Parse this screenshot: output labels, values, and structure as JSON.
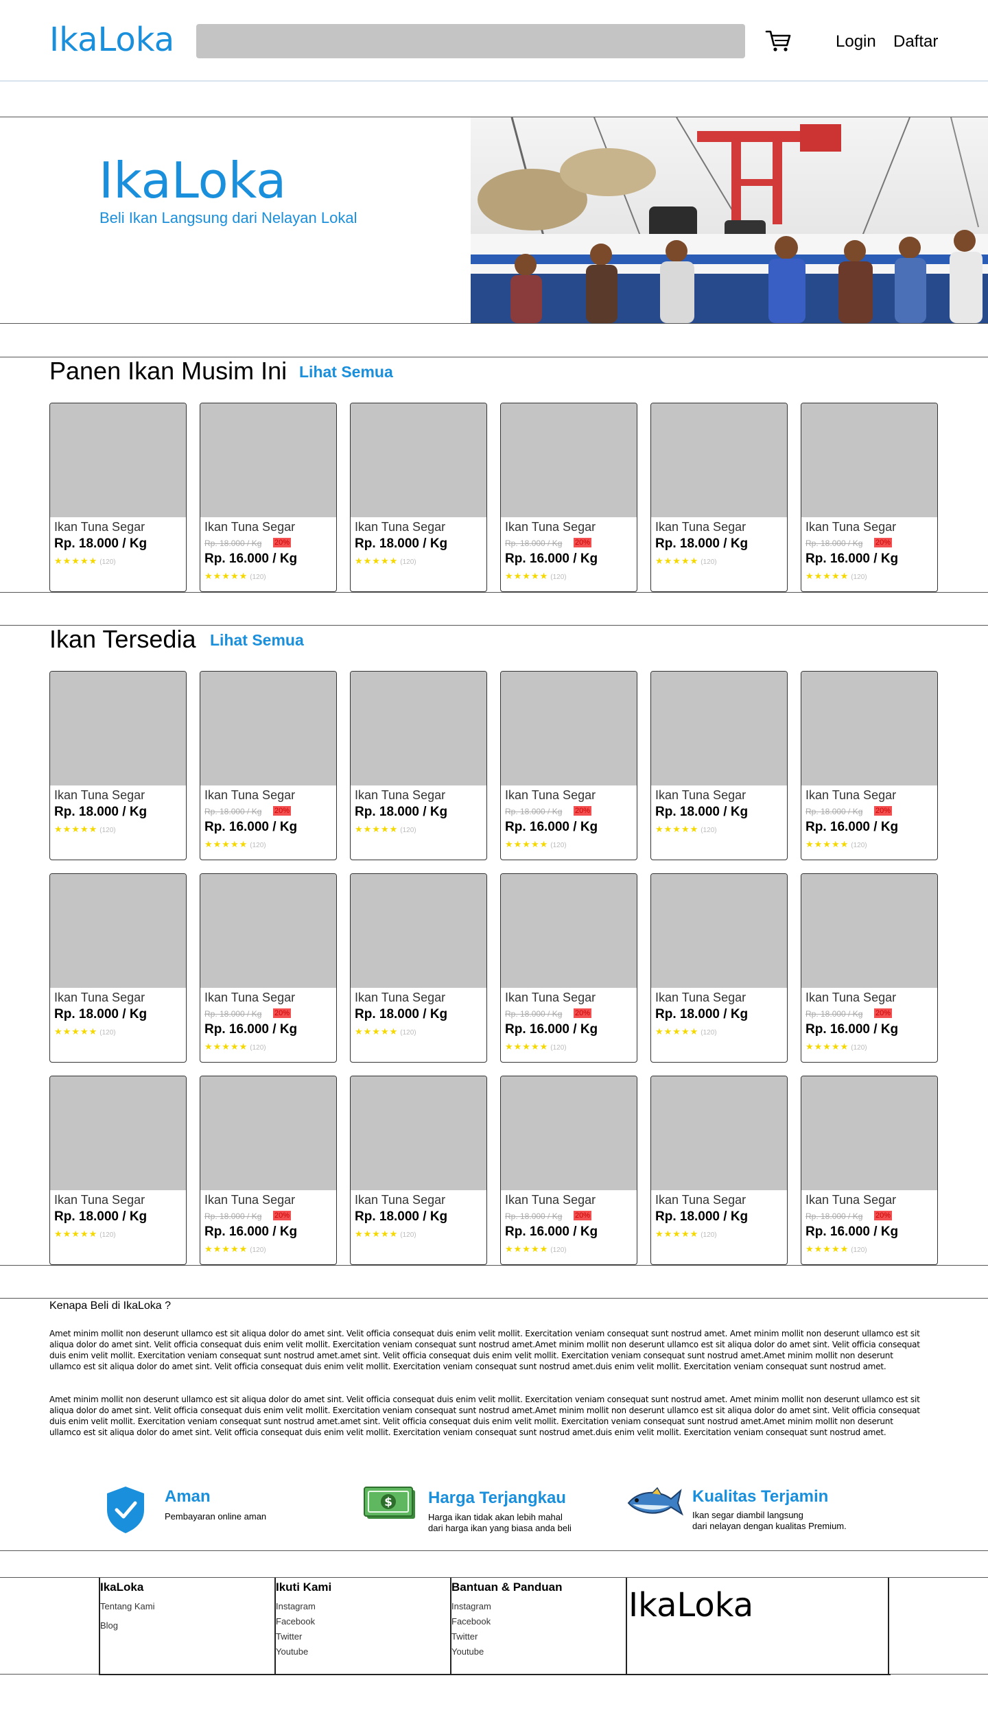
{
  "header": {
    "logo": "IkaLoka",
    "search_placeholder": "",
    "login_label": "Login",
    "register_label": "Daftar"
  },
  "hero": {
    "title": "IkaLoka",
    "subtitle": "Beli Ikan Langsung dari Nelayan Lokal"
  },
  "harvest": {
    "title": "Panen Ikan Musim Ini",
    "link": "Lihat Semua"
  },
  "available": {
    "title": "Ikan Tersedia",
    "link": "Lihat Semua"
  },
  "product": {
    "name": "Ikan Tuna Segar",
    "price": "Rp. 18.000 / Kg",
    "old_price": "Rp. 18.000 / Kg",
    "discount_price": "Rp. 16.000 / Kg",
    "discount_pct": "20%",
    "stars": "★★★★★",
    "rating_count": "(120)"
  },
  "why": {
    "title": "Kenapa Beli di IkaLoka ?",
    "paragraph_1": "Amet minim mollit non deserunt ullamco est sit aliqua dolor do amet sint. Velit officia consequat duis enim velit mollit. Exercitation veniam consequat sunt nostrud amet. Amet minim mollit non deserunt ullamco est sit aliqua dolor do amet sint. Velit officia consequat duis enim velit mollit. Exercitation veniam consequat sunt nostrud amet.Amet minim mollit non deserunt ullamco est sit aliqua dolor do amet sint. Velit officia consequat duis enim velit mollit. Exercitation veniam consequat sunt nostrud amet.amet sint. Velit officia consequat duis enim velit mollit. Exercitation veniam consequat sunt nostrud amet.Amet minim mollit non deserunt ullamco est sit aliqua dolor do amet sint. Velit officia consequat duis enim velit mollit. Exercitation veniam consequat sunt nostrud amet.duis enim velit mollit. Exercitation veniam consequat sunt nostrud amet.",
    "paragraph_2": "Amet minim mollit non deserunt ullamco est sit aliqua dolor do amet sint. Velit officia consequat duis enim velit mollit. Exercitation veniam consequat sunt nostrud amet. Amet minim mollit non deserunt ullamco est sit aliqua dolor do amet sint. Velit officia consequat duis enim velit mollit. Exercitation veniam consequat sunt nostrud amet.Amet minim mollit non deserunt ullamco est sit aliqua dolor do amet sint. Velit officia consequat duis enim velit mollit. Exercitation veniam consequat sunt nostrud amet.amet sint. Velit officia consequat duis enim velit mollit. Exercitation veniam consequat sunt nostrud amet.Amet minim mollit non deserunt ullamco est sit aliqua dolor do amet sint. Velit officia consequat duis enim velit mollit. Exercitation veniam consequat sunt nostrud amet.duis enim velit mollit. Exercitation veniam consequat sunt nostrud amet.",
    "features": [
      {
        "title": "Aman",
        "desc": "Pembayaran online aman",
        "icon": "shield-check-icon"
      },
      {
        "title": "Harga Terjangkau",
        "desc_line1": "Harga ikan tidak akan lebih mahal",
        "desc_line2": "dari harga ikan yang biasa anda beli",
        "icon": "money-icon"
      },
      {
        "title": "Kualitas Terjamin",
        "desc_line1": "Ikan segar diambil langsung",
        "desc_line2": "dari nelayan dengan kualitas Premium.",
        "icon": "fish-icon"
      }
    ]
  },
  "footer": {
    "col1": {
      "title": "IkaLoka",
      "links": [
        "Tentang Kami",
        "Blog"
      ]
    },
    "col2": {
      "title": "Ikuti Kami",
      "links": [
        "Instagram",
        "Facebook",
        "Twitter",
        "Youtube"
      ]
    },
    "col3": {
      "title": "Bantuan & Panduan",
      "links": [
        "Instagram",
        "Facebook",
        "Twitter",
        "Youtube"
      ]
    },
    "logo": "IkaLoka"
  },
  "colors": {
    "brand": "#1a8fdb",
    "placeholder": "#c4c4c4",
    "star": "#f5d800",
    "discount": "#f25050"
  }
}
